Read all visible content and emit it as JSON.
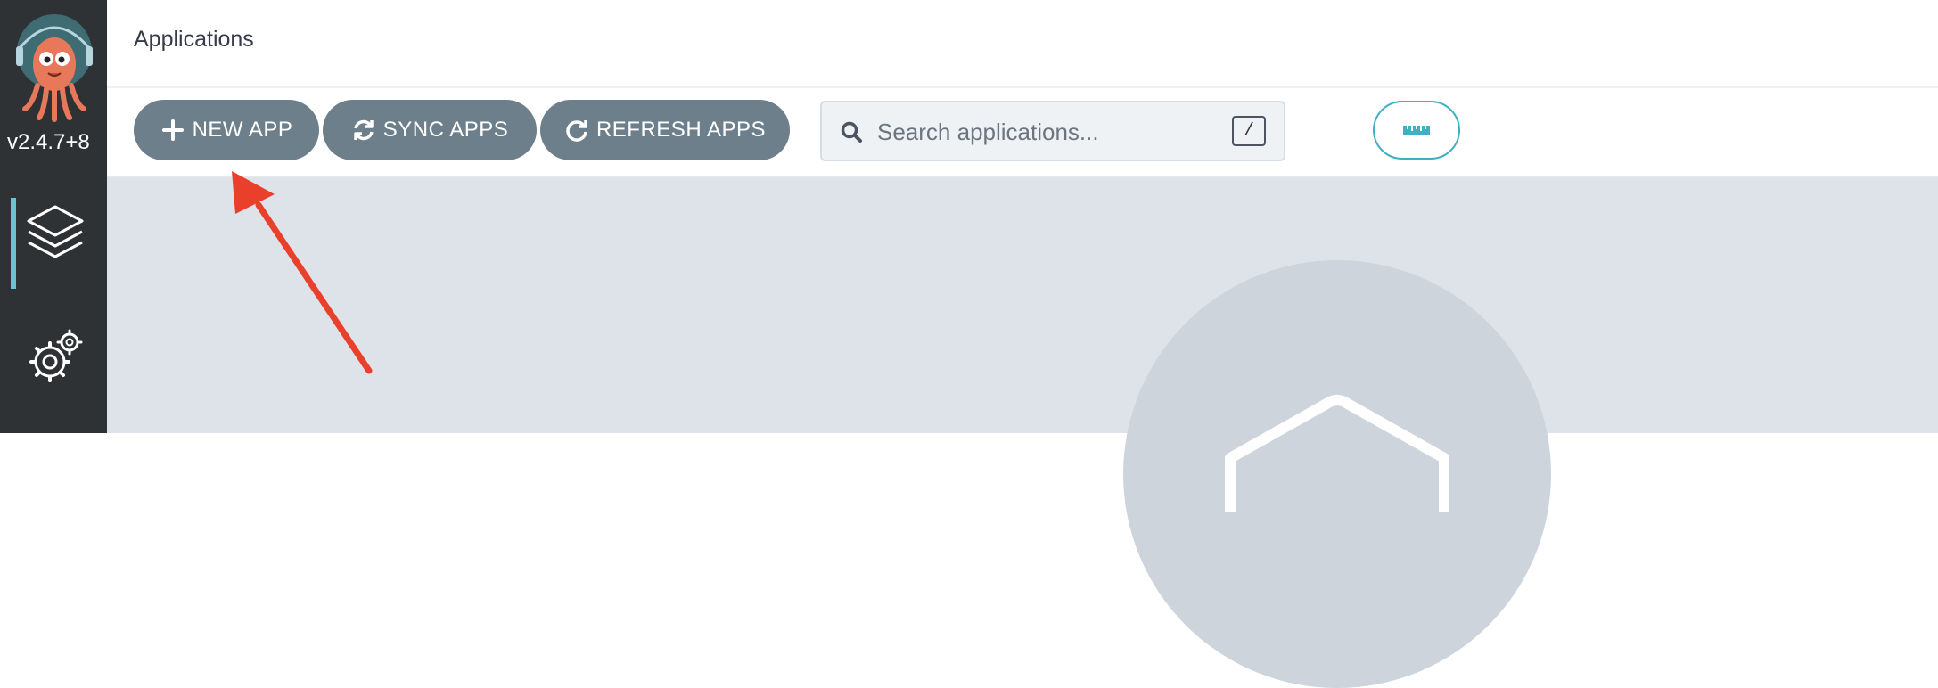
{
  "sidebar": {
    "version": "v2.4.7+8",
    "nav": [
      {
        "icon": "stacked-layers-icon",
        "active": true
      },
      {
        "icon": "gears-icon",
        "active": false
      }
    ],
    "accent_color": "#6bc2d2",
    "logo_icon": "octopus-mascot-icon"
  },
  "header": {
    "title": "Applications"
  },
  "toolbar": {
    "new_app_label": "NEW APP",
    "sync_apps_label": "SYNC APPS",
    "refresh_apps_label": "REFRESH APPS",
    "search_placeholder": "Search applications...",
    "search_shortcut": "/",
    "view_toggle_icon": "ruler-icon",
    "button_color": "#6d7f8b"
  },
  "annotation": {
    "arrow_color": "#e8402b",
    "arrow_icon": "red-arrow-pointing-to-new-app"
  },
  "content": {
    "empty_state_icon": "empty-box-icon"
  }
}
